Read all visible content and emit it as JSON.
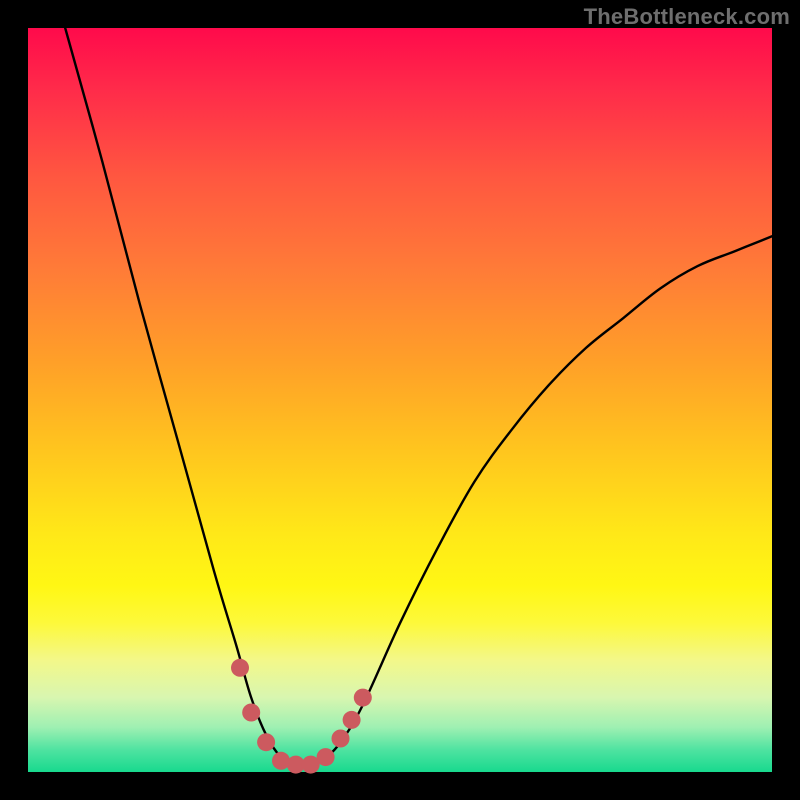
{
  "watermark": "TheBottleneck.com",
  "colors": {
    "background_frame": "#000000",
    "curve_stroke": "#000000",
    "marker_fill": "#cc5a5f",
    "gradient_top": "#ff0a4b",
    "gradient_bottom": "#18d98e"
  },
  "chart_data": {
    "type": "line",
    "title": "",
    "xlabel": "",
    "ylabel": "",
    "xlim": [
      0,
      100
    ],
    "ylim": [
      0,
      100
    ],
    "note": "No axis labels or tick labels visible; values estimated from pixel position. y=0 at bottom (green), y=100 at top (red). Curve dips to ~0 near x≈35.",
    "series": [
      {
        "name": "bottleneck-curve",
        "x": [
          5,
          10,
          15,
          20,
          25,
          28,
          30,
          32,
          34,
          36,
          38,
          40,
          42,
          45,
          50,
          55,
          60,
          65,
          70,
          75,
          80,
          85,
          90,
          95,
          100
        ],
        "y": [
          100,
          82,
          63,
          45,
          27,
          17,
          10,
          5,
          2,
          1,
          1,
          2,
          4,
          9,
          20,
          30,
          39,
          46,
          52,
          57,
          61,
          65,
          68,
          70,
          72
        ]
      }
    ],
    "markers": {
      "name": "highlighted-points",
      "x": [
        28.5,
        30,
        32,
        34,
        36,
        38,
        40,
        42,
        43.5,
        45
      ],
      "y": [
        14,
        8,
        4,
        1.5,
        1,
        1,
        2,
        4.5,
        7,
        10
      ]
    }
  }
}
